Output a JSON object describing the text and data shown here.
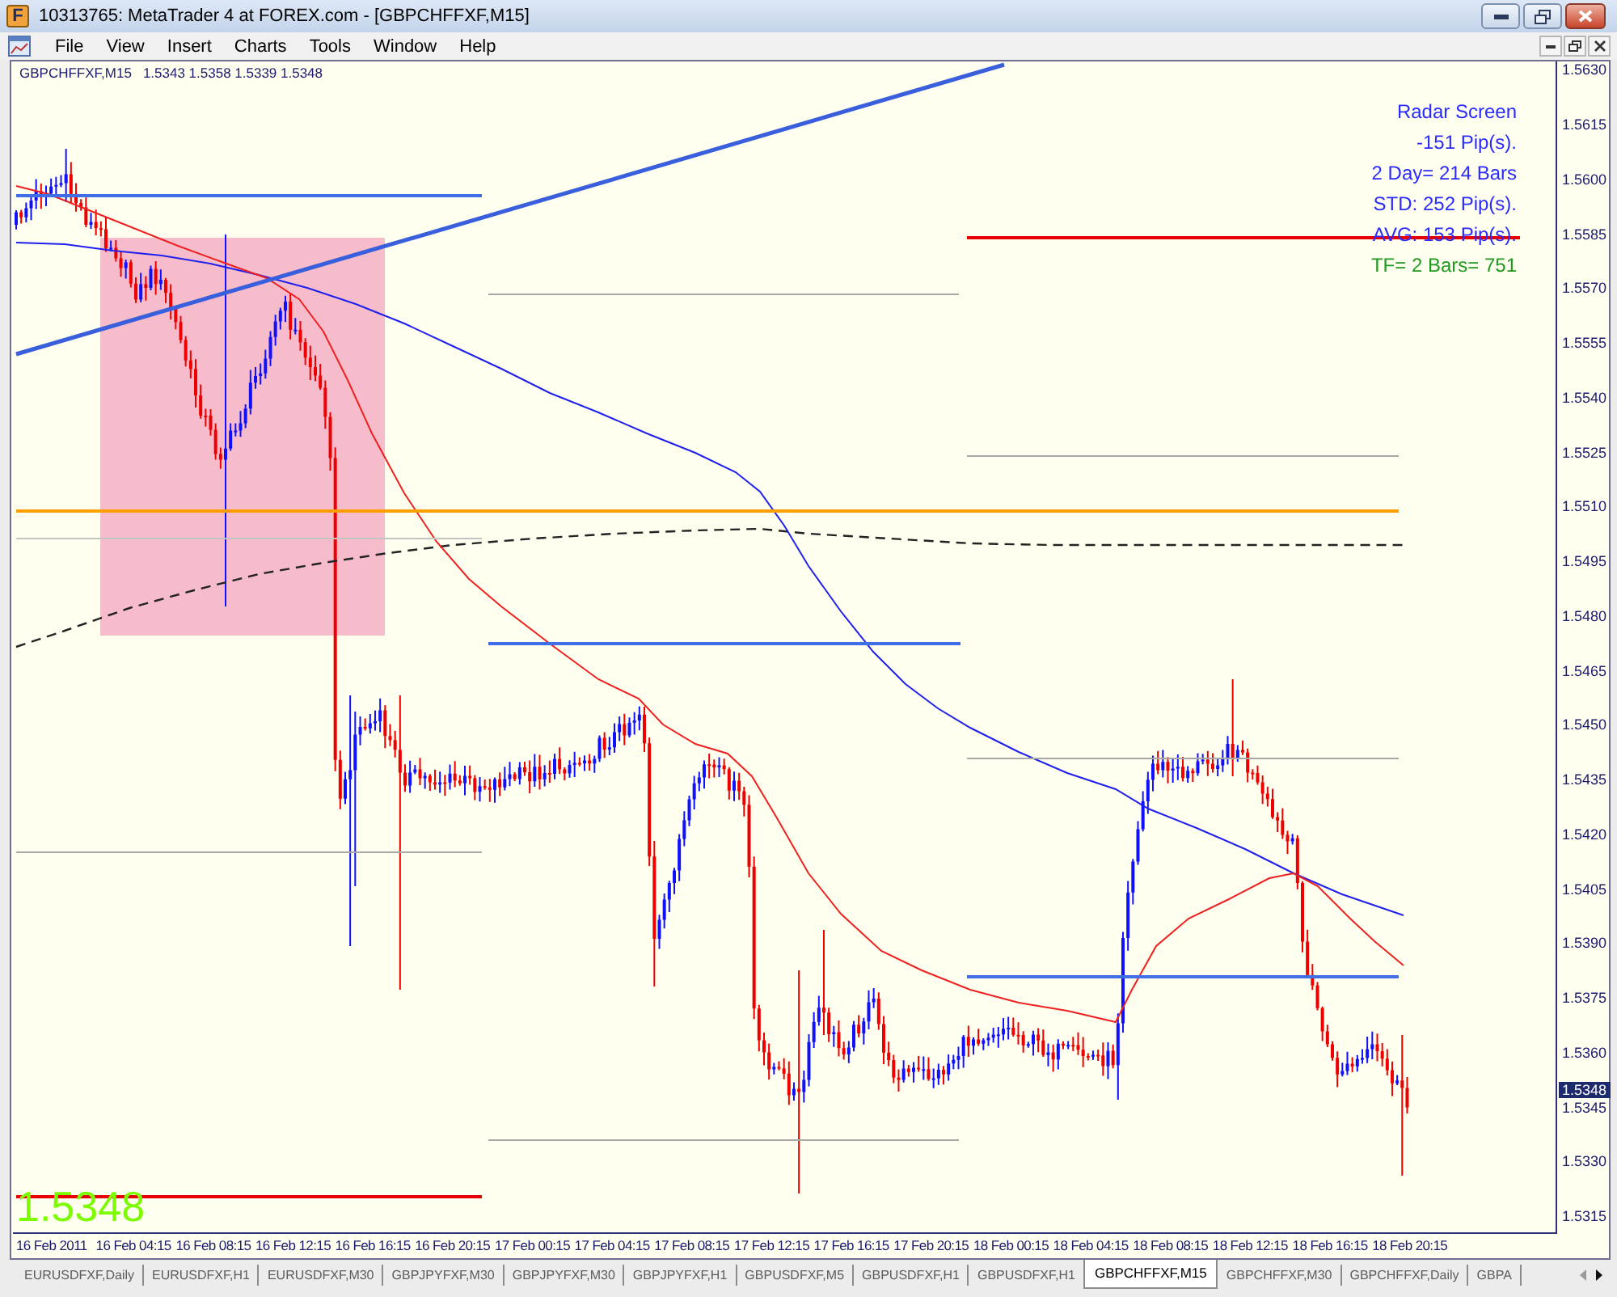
{
  "window": {
    "logo_text": "F",
    "title": "10313765: MetaTrader 4 at FOREX.com - [GBPCHFFXF,M15]"
  },
  "menu": [
    "File",
    "View",
    "Insert",
    "Charts",
    "Tools",
    "Window",
    "Help"
  ],
  "chart": {
    "symbol": "GBPCHFFXF,M15",
    "ohlc": "1.5343 1.5358 1.5339 1.5348",
    "info_lines": [
      {
        "text": "Radar Screen",
        "color": "#2b2bff"
      },
      {
        "text": "-151 Pip(s).",
        "color": "#2b2bff"
      },
      {
        "text": "2 Day= 214 Bars",
        "color": "#2b2bff"
      },
      {
        "text": "STD: 252 Pip(s).",
        "color": "#2b2bff"
      },
      {
        "text": "AVG: 153 Pip(s).",
        "color": "#2b2bff"
      },
      {
        "text": "TF= 2 Bars= 751",
        "color": "#1f9a1f"
      }
    ],
    "price_label": "1.5348",
    "price_axis": {
      "labels": [
        "1.5630",
        "1.5615",
        "1.5600",
        "1.5585",
        "1.5570",
        "1.5555",
        "1.5540",
        "1.5525",
        "1.5510",
        "1.5495",
        "1.5480",
        "1.5465",
        "1.5450",
        "1.5435",
        "1.5420",
        "1.5405",
        "1.5390",
        "1.5375",
        "1.5360",
        "1.5345",
        "1.5330",
        "1.5315"
      ],
      "current_price": "1.5348"
    },
    "time_axis": {
      "labels": [
        "16 Feb 2011",
        "16 Feb 04:15",
        "16 Feb 08:15",
        "16 Feb 12:15",
        "16 Feb 16:15",
        "16 Feb 20:15",
        "17 Feb 00:15",
        "17 Feb 04:15",
        "17 Feb 08:15",
        "17 Feb 12:15",
        "17 Feb 16:15",
        "17 Feb 20:15",
        "18 Feb 00:15",
        "18 Feb 04:15",
        "18 Feb 08:15",
        "18 Feb 12:15",
        "18 Feb 16:15",
        "18 Feb 20:15"
      ]
    }
  },
  "tabs": [
    {
      "label": "EURUSDFXF,Daily",
      "selected": false
    },
    {
      "label": "EURUSDFXF,H1",
      "selected": false
    },
    {
      "label": "EURUSDFXF,M30",
      "selected": false
    },
    {
      "label": "GBPJPYFXF,M30",
      "selected": false
    },
    {
      "label": "GBPJPYFXF,M30",
      "selected": false
    },
    {
      "label": "GBPJPYFXF,H1",
      "selected": false
    },
    {
      "label": "GBPUSDFXF,M5",
      "selected": false
    },
    {
      "label": "GBPUSDFXF,H1",
      "selected": false
    },
    {
      "label": "GBPUSDFXF,H1",
      "selected": false
    },
    {
      "label": "GBPCHFFXF,M15",
      "selected": true
    },
    {
      "label": "GBPCHFFXF,M30",
      "selected": false
    },
    {
      "label": "GBPCHFFXF,Daily",
      "selected": false
    },
    {
      "label": "GBPA",
      "selected": false
    }
  ]
}
